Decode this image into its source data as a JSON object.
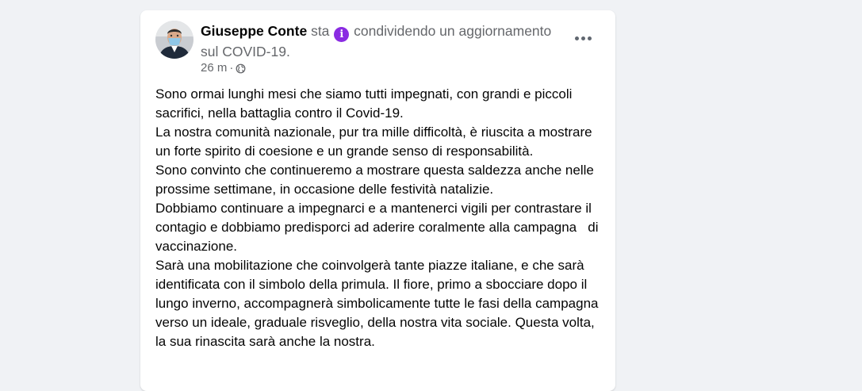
{
  "post": {
    "author": "Giuseppe Conte",
    "activity_prefix": "sta",
    "activity_icon": "info-circle-icon",
    "activity_text": "condividendo un aggiornamento sul COVID-19.",
    "timestamp": "26 m",
    "separator": "·",
    "audience_icon": "globe-icon",
    "more_icon": "more-options-icon",
    "accent_color": "#8a2be2",
    "paragraphs": [
      "Sono ormai lunghi mesi che siamo tutti impegnati, con grandi e piccoli sacrifici, nella battaglia contro il Covid-19.",
      "La nostra comunità nazionale, pur tra mille difficoltà, è riuscita a mostrare un forte spirito di coesione e un grande senso di responsabilità.",
      "Sono convinto che continueremo a mostrare questa saldezza anche nelle prossime settimane, in occasione delle festività natalizie.",
      "Dobbiamo continuare a impegnarci e a mantenerci vigili per contrastare il contagio e dobbiamo predisporci ad aderire coralmente alla campagna   di vaccinazione.",
      "Sarà una mobilitazione che coinvolgerà tante piazze italiane, e che sarà identificata con il simbolo della primula. Il fiore, primo a sbocciare dopo il lungo inverno, accompagnerà simbolicamente tutte le fasi della campagna verso un ideale, graduale risveglio, della nostra vita sociale. Questa volta, la sua rinascita sarà anche la nostra."
    ]
  }
}
